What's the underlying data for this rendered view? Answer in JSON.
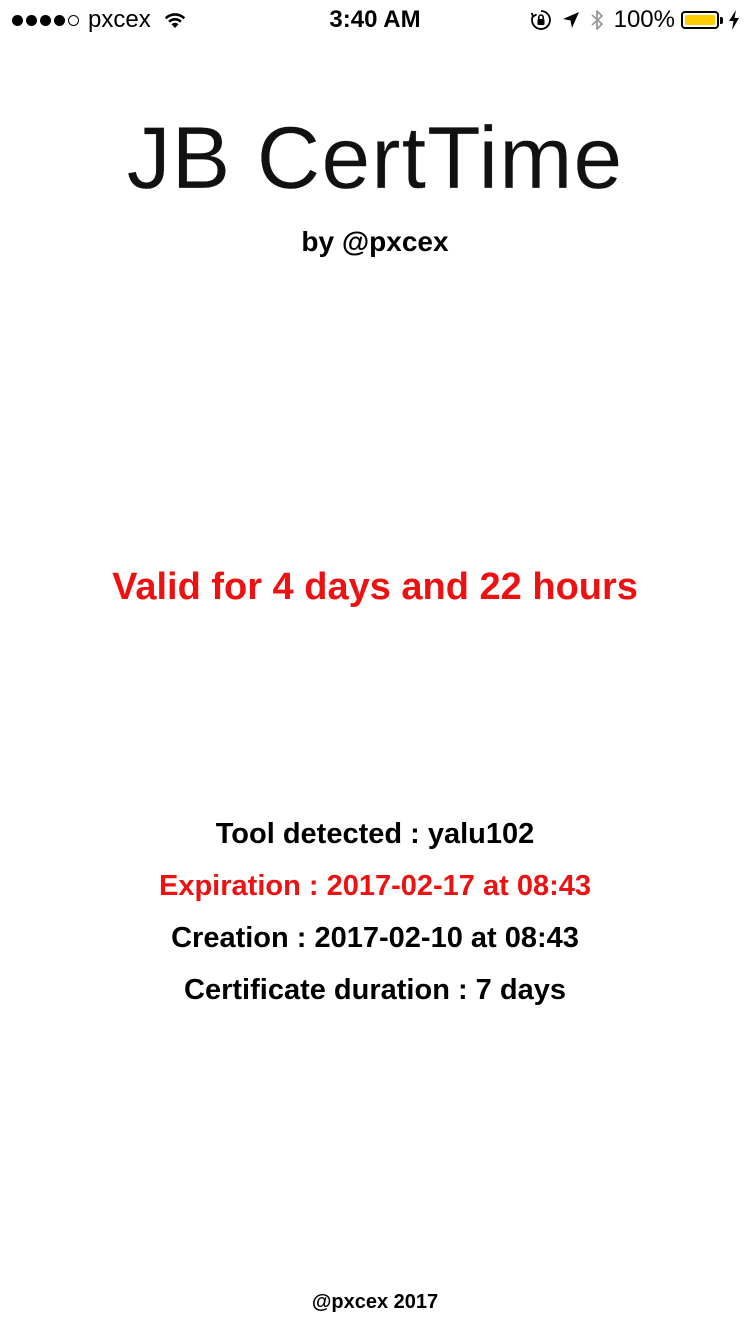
{
  "status_bar": {
    "signal_bars_filled": 4,
    "signal_bars_total": 5,
    "carrier": "pxcex",
    "time": "3:40 AM",
    "battery_percent": "100%",
    "battery_color": "#ffcc00",
    "icons": [
      "wifi-icon",
      "orientation-lock-icon",
      "location-arrow-icon",
      "bluetooth-icon",
      "battery-icon",
      "charging-bolt-icon"
    ]
  },
  "header": {
    "title": "JB CertTime",
    "author": "by @pxcex"
  },
  "main": {
    "validity_text": "Valid for 4 days and 22 hours",
    "validity_color": "#ee1111"
  },
  "details": {
    "tool_detected": "Tool detected : yalu102",
    "expiration": "Expiration : 2017-02-17 at 08:43",
    "expiration_color": "#ee1111",
    "creation": "Creation : 2017-02-10 at 08:43",
    "certificate_duration": "Certificate duration : 7 days"
  },
  "footer": {
    "text": "@pxcex 2017"
  }
}
